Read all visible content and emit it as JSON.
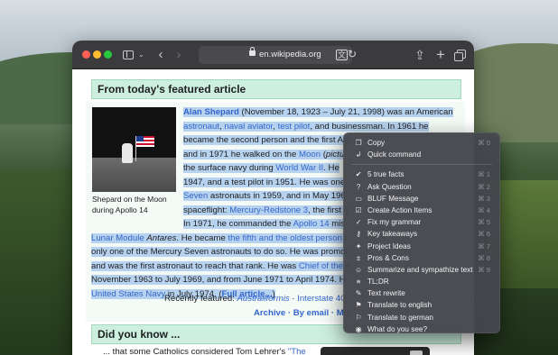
{
  "browser": {
    "url": "en.wikipedia.org"
  },
  "featured": {
    "heading": "From today's featured article",
    "caption_line1": "Shepard on the Moon",
    "caption_line2": "during Apollo 14",
    "lines": [
      [
        {
          "t": "Alan Shepard",
          "c": "hl bold lk"
        },
        {
          "t": " (November 18, 1923 – July 21, 1998) was an American",
          "c": "hl"
        }
      ],
      [
        {
          "t": "astronaut",
          "c": "hl lk"
        },
        {
          "t": ", ",
          "c": "hl"
        },
        {
          "t": "naval aviator",
          "c": "hl lk"
        },
        {
          "t": ", ",
          "c": "hl"
        },
        {
          "t": "test pilot",
          "c": "hl lk"
        },
        {
          "t": ", and businessman. In 1961 he",
          "c": "hl"
        }
      ],
      [
        {
          "t": "became the second person and the first Am",
          "c": "hl"
        }
      ],
      [
        {
          "t": "and in 1971 he walked on the ",
          "c": "hl"
        },
        {
          "t": "Moon",
          "c": "hl lk"
        },
        {
          "t": " (",
          "c": "hl"
        },
        {
          "t": "pictu",
          "c": "hl it"
        }
      ],
      [
        {
          "t": "the surface navy during ",
          "c": "hl"
        },
        {
          "t": "World War II",
          "c": "hl lk"
        },
        {
          "t": ". He",
          "c": "hl"
        }
      ],
      [
        {
          "t": "1947, and a test pilot in 1951. He was one",
          "c": "hl"
        }
      ],
      [
        {
          "t": "Seven",
          "c": "hl lk"
        },
        {
          "t": " astronauts in 1959, and in May 196",
          "c": "hl"
        }
      ],
      [
        {
          "t": "spaceflight: ",
          "c": "hl"
        },
        {
          "t": "Mercury-Redstone 3",
          "c": "hl lk"
        },
        {
          "t": ", the first o",
          "c": "hl"
        }
      ],
      [
        {
          "t": "In 1971, he commanded the ",
          "c": "hl"
        },
        {
          "t": "Apollo 14",
          "c": "hl lk"
        },
        {
          "t": " mis",
          "c": "hl"
        }
      ],
      [
        {
          "t": "Lunar Module",
          "c": "hl lk"
        },
        {
          "t": " ",
          "c": "hl"
        },
        {
          "t": "Antares",
          "c": "hl it"
        },
        {
          "t": ". He became ",
          "c": "hl"
        },
        {
          "t": "the fifth and the oldest person t",
          "c": "hl lk"
        }
      ],
      [
        {
          "t": "only one of the Mercury Seven astronauts to do so. He was promot",
          "c": "hl"
        }
      ],
      [
        {
          "t": "and was the first astronaut to reach that rank. He was ",
          "c": "hl"
        },
        {
          "t": "Chief of the A",
          "c": "hl lk"
        }
      ],
      [
        {
          "t": "November 1963 to July 1969, and from June 1971 to April 1974. H",
          "c": "hl"
        }
      ],
      [
        {
          "t": "United States Navy",
          "c": "hl lk"
        },
        {
          "t": " in July 1974. (",
          "c": "hl"
        },
        {
          "t": "Full article...",
          "c": "hl bold lk"
        },
        {
          "t": ")",
          "c": "hl"
        }
      ]
    ],
    "recently_label": "Recently featured: ",
    "recently_items": [
      "Australiformis",
      "Interstate 40"
    ],
    "recently_sep": " · ",
    "archive_text": "Archive · By email · Mo"
  },
  "dyk": {
    "heading": "Did you know ...",
    "first_item_prefix": "... that some Catholics considered Tom Lehrer's ",
    "first_item_link": "\"The"
  },
  "context_menu": {
    "groups": [
      [
        {
          "label": "Copy",
          "icon": "copy-icon",
          "glyph": "❐",
          "shortcut": "⌘ 0"
        },
        {
          "label": "Quick command",
          "icon": "quick-command-icon",
          "glyph": "↲",
          "shortcut": ""
        }
      ],
      [
        {
          "label": "5 true facts",
          "icon": "check-circle-icon",
          "glyph": "✔",
          "shortcut": "⌘ 1"
        },
        {
          "label": "Ask Question",
          "icon": "person-question-icon",
          "glyph": "?",
          "shortcut": "⌘ 2"
        },
        {
          "label": "BLUF Message",
          "icon": "message-icon",
          "glyph": "▭",
          "shortcut": "⌘ 3"
        },
        {
          "label": "Create Action Items",
          "icon": "checklist-icon",
          "glyph": "☑",
          "shortcut": "⌘ 4"
        },
        {
          "label": "Fix my grammar",
          "icon": "grammar-icon",
          "glyph": "✓",
          "shortcut": "⌘ 5"
        },
        {
          "label": "Key takeaways",
          "icon": "key-icon",
          "glyph": "⚷",
          "shortcut": "⌘ 6"
        },
        {
          "label": "Project Ideas",
          "icon": "lightbulb-icon",
          "glyph": "✦",
          "shortcut": "⌘ 7"
        },
        {
          "label": "Pros & Cons",
          "icon": "thumbs-up-icon",
          "glyph": "±",
          "shortcut": "⌘ 8"
        },
        {
          "label": "Summarize and sympathize text",
          "icon": "summarize-icon",
          "glyph": "☺",
          "shortcut": "⌘ 9"
        },
        {
          "label": "TL;DR",
          "icon": "list-icon",
          "glyph": "≡",
          "shortcut": ""
        },
        {
          "label": "Text rewrite",
          "icon": "rewrite-icon",
          "glyph": "✎",
          "shortcut": ""
        },
        {
          "label": "Translate to english",
          "icon": "flag-icon",
          "glyph": "⚑",
          "shortcut": ""
        },
        {
          "label": "Translate to german",
          "icon": "flag-outline-icon",
          "glyph": "⚐",
          "shortcut": ""
        },
        {
          "label": "What do you see?",
          "icon": "eye-icon",
          "glyph": "◉",
          "shortcut": ""
        }
      ]
    ]
  }
}
